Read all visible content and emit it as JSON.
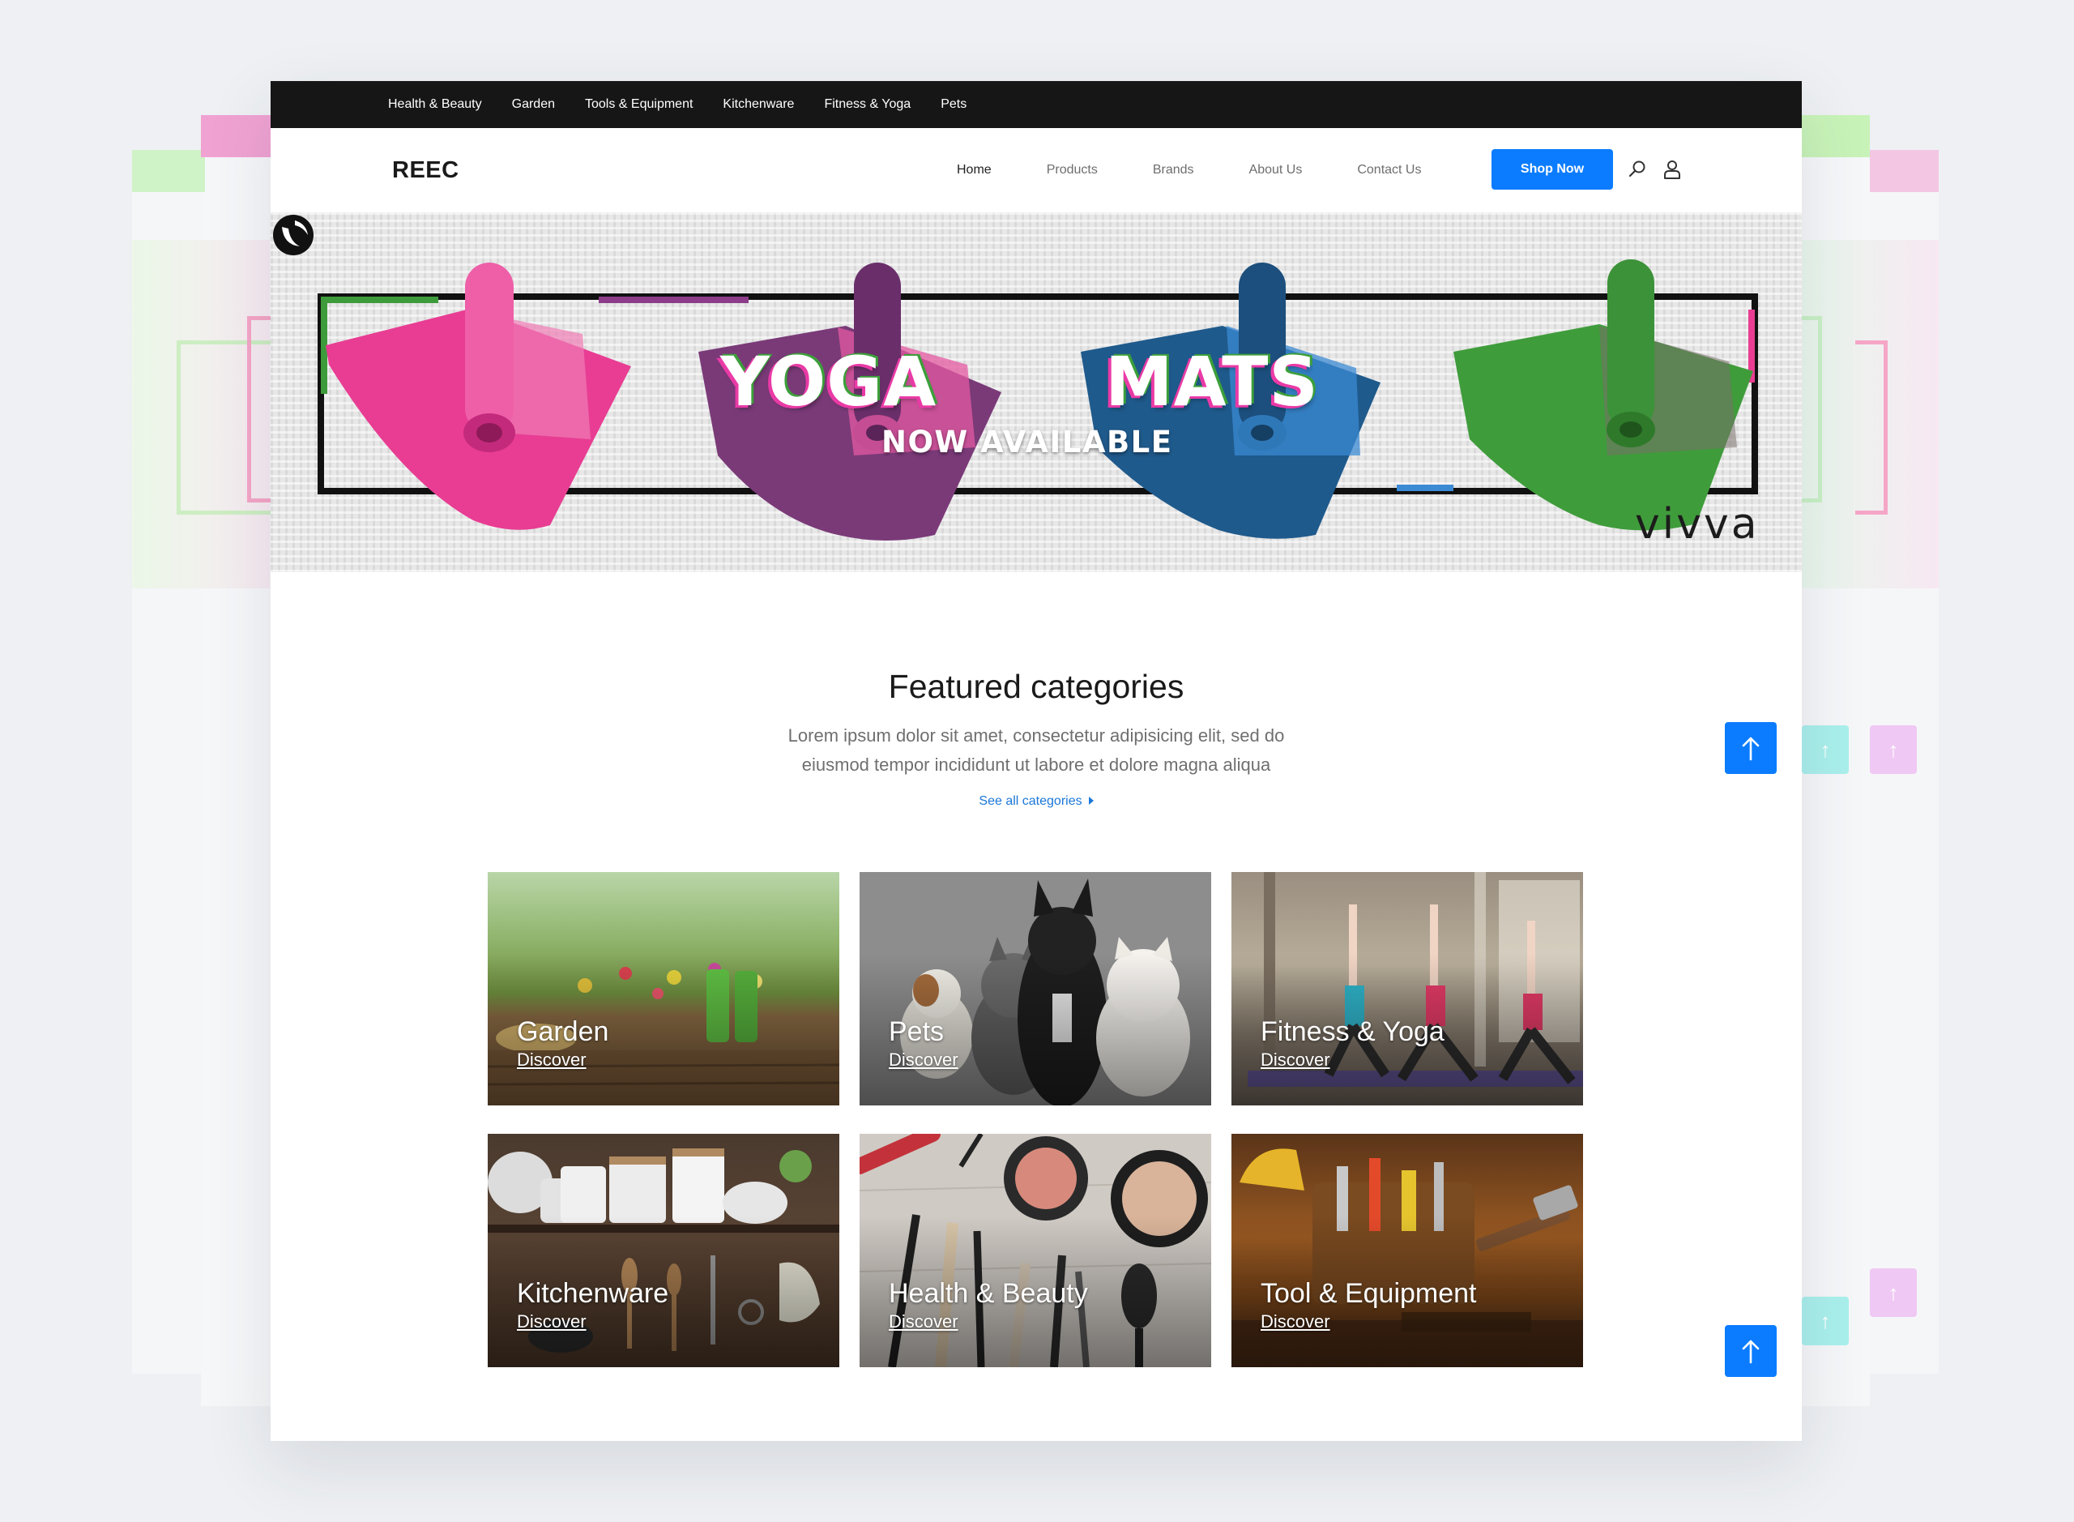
{
  "top_categories": [
    "Health & Beauty",
    "Garden",
    "Tools & Equipment",
    "Kitchenware",
    "Fitness & Yoga",
    "Pets"
  ],
  "brand": "REEC",
  "nav": {
    "links": [
      "Home",
      "Products",
      "Brands",
      "About Us",
      "Contact Us"
    ],
    "active": "Home",
    "cta": "Shop Now",
    "icons": [
      "search-icon",
      "user-icon"
    ],
    "accent_color": "#0b7cff"
  },
  "hero": {
    "word1": "YOGA",
    "word2": "MATS",
    "subtitle": "NOW AVAILABLE",
    "brand": "vivva",
    "mat_colors": [
      "#e83d93",
      "#7a3a78",
      "#1f5a8c",
      "#3f9c3b"
    ]
  },
  "featured": {
    "title": "Featured categories",
    "description_line1": "Lorem ipsum dolor sit amet, consectetur adipisicing elit, sed do",
    "description_line2": "eiusmod tempor incididunt ut labore et dolore magna aliqua",
    "link": "See all categories",
    "cards": [
      {
        "name": "Garden",
        "action": "Discover"
      },
      {
        "name": "Pets",
        "action": "Discover"
      },
      {
        "name": "Fitness & Yoga",
        "action": "Discover"
      },
      {
        "name": "Kitchenware",
        "action": "Discover"
      },
      {
        "name": "Health & Beauty",
        "action": "Discover"
      },
      {
        "name": "Tool & Equipment",
        "action": "Discover"
      }
    ]
  }
}
